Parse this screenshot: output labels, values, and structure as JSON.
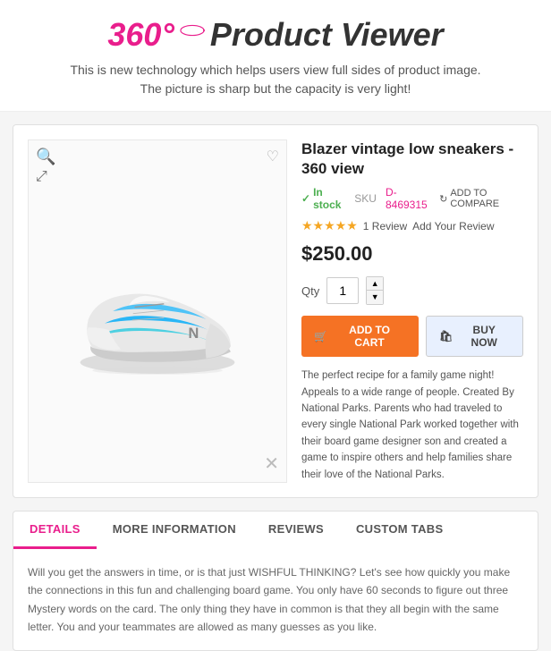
{
  "hero": {
    "badge": "360°",
    "title": "Product Viewer",
    "subtitle_line1": "This is new technology which helps users view full sides of product image.",
    "subtitle_line2": "The picture is sharp but the capacity is very light!"
  },
  "product": {
    "name": "Blazer vintage low sneakers - 360 view",
    "in_stock": "In stock",
    "sku_label": "SKU",
    "sku_value": "D-8469315",
    "compare_label": "ADD TO COMPARE",
    "stars": "★★★★★",
    "review_count": "1 Review",
    "add_review": "Add Your Review",
    "price": "$250.00",
    "qty_label": "Qty",
    "qty_value": "1",
    "btn_cart": "ADD TO CART",
    "btn_buy": "BUY NOW",
    "description": "The perfect recipe for a family game night! Appeals to a wide range of people. Created By National Parks. Parents who had traveled to every single National Park worked together with their board game designer son and created a game to inspire others and help families share their love of the National Parks."
  },
  "tabs": {
    "items": [
      {
        "id": "details",
        "label": "DETAILS",
        "active": true
      },
      {
        "id": "more-information",
        "label": "MORE INFORMATION",
        "active": false
      },
      {
        "id": "reviews",
        "label": "REVIEWS",
        "active": false
      },
      {
        "id": "custom-tabs",
        "label": "CUSTOM TABS",
        "active": false
      }
    ],
    "content": "Will you get the answers in time, or is that just WISHFUL THINKING? Let's see how quickly you make the connections in this fun and challenging board game. You only have 60 seconds to figure out three Mystery words on the card. The only thing they have in common is that they all begin with the same letter. You and your teammates are allowed as many guesses as you like."
  }
}
